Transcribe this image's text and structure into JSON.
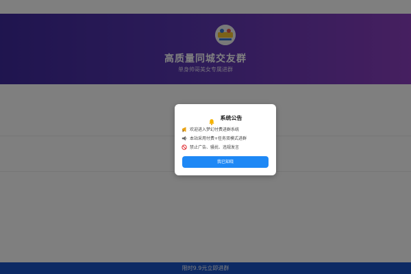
{
  "hero": {
    "title": "高质量同城交友群",
    "subtitle": "单身帅哥美女专属进群",
    "logo_icon": "group-logo-icon"
  },
  "bottom_bar": {
    "label": "限时9.9元立即进群"
  },
  "modal": {
    "title": "系统公告",
    "title_icon": "bell-icon",
    "notices": [
      {
        "icon": "megaphone-icon",
        "text": "欢迎进入梦幻付费进群系统"
      },
      {
        "icon": "loudspeaker-icon",
        "text": "本站采用付费+任务双模式进群"
      },
      {
        "icon": "prohibited-icon",
        "text": "禁止广告、骚扰、违规发言"
      }
    ],
    "ack_label": "我已知晓"
  },
  "colors": {
    "hero_gradient_start": "#3f2a9e",
    "hero_gradient_end": "#8c3fc0",
    "button": "#1e88f5",
    "bottom_bar": "#1a55c8"
  }
}
